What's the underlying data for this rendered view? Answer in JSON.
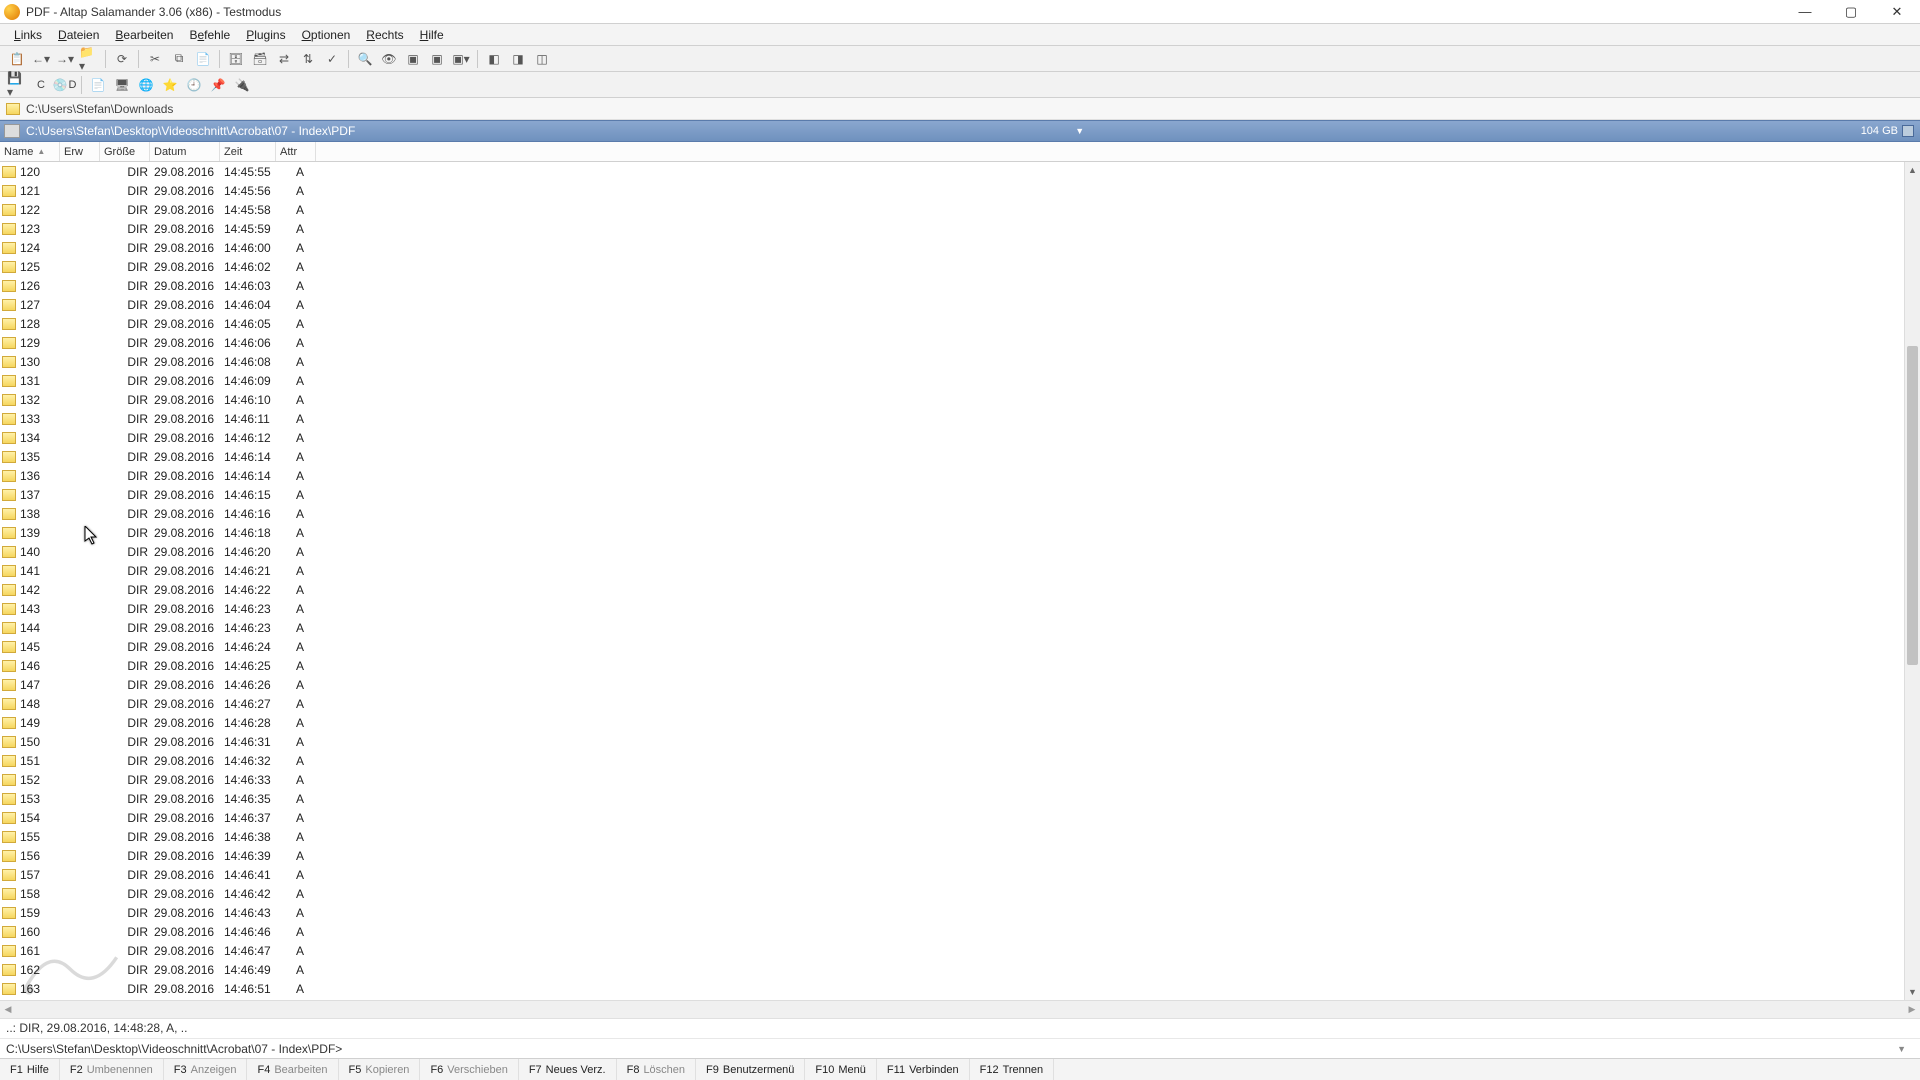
{
  "title": "PDF - Altap Salamander 3.06 (x86) - Testmodus",
  "menu": [
    "Links",
    "Dateien",
    "Bearbeiten",
    "Befehle",
    "Plugins",
    "Optionen",
    "Rechts",
    "Hilfe"
  ],
  "menu_accel": [
    "L",
    "D",
    "B",
    "e",
    "P",
    "O",
    "R",
    "H"
  ],
  "drivebar": {
    "c": "C",
    "d": "D"
  },
  "inactive_path": "C:\\Users\\Stefan\\Downloads",
  "active_path": "C:\\Users\\Stefan\\Desktop\\Videoschnitt\\Acrobat\\07 - Index\\PDF",
  "free_space": "104 GB",
  "columns": {
    "name": "Name",
    "ext": "Erw",
    "size": "Größe",
    "date": "Datum",
    "time": "Zeit",
    "attr": "Attr"
  },
  "rows": [
    {
      "name": "120",
      "size": "DIR",
      "date": "29.08.2016",
      "time": "14:45:55",
      "attr": "A"
    },
    {
      "name": "121",
      "size": "DIR",
      "date": "29.08.2016",
      "time": "14:45:56",
      "attr": "A"
    },
    {
      "name": "122",
      "size": "DIR",
      "date": "29.08.2016",
      "time": "14:45:58",
      "attr": "A"
    },
    {
      "name": "123",
      "size": "DIR",
      "date": "29.08.2016",
      "time": "14:45:59",
      "attr": "A"
    },
    {
      "name": "124",
      "size": "DIR",
      "date": "29.08.2016",
      "time": "14:46:00",
      "attr": "A"
    },
    {
      "name": "125",
      "size": "DIR",
      "date": "29.08.2016",
      "time": "14:46:02",
      "attr": "A"
    },
    {
      "name": "126",
      "size": "DIR",
      "date": "29.08.2016",
      "time": "14:46:03",
      "attr": "A"
    },
    {
      "name": "127",
      "size": "DIR",
      "date": "29.08.2016",
      "time": "14:46:04",
      "attr": "A"
    },
    {
      "name": "128",
      "size": "DIR",
      "date": "29.08.2016",
      "time": "14:46:05",
      "attr": "A"
    },
    {
      "name": "129",
      "size": "DIR",
      "date": "29.08.2016",
      "time": "14:46:06",
      "attr": "A"
    },
    {
      "name": "130",
      "size": "DIR",
      "date": "29.08.2016",
      "time": "14:46:08",
      "attr": "A"
    },
    {
      "name": "131",
      "size": "DIR",
      "date": "29.08.2016",
      "time": "14:46:09",
      "attr": "A"
    },
    {
      "name": "132",
      "size": "DIR",
      "date": "29.08.2016",
      "time": "14:46:10",
      "attr": "A"
    },
    {
      "name": "133",
      "size": "DIR",
      "date": "29.08.2016",
      "time": "14:46:11",
      "attr": "A"
    },
    {
      "name": "134",
      "size": "DIR",
      "date": "29.08.2016",
      "time": "14:46:12",
      "attr": "A"
    },
    {
      "name": "135",
      "size": "DIR",
      "date": "29.08.2016",
      "time": "14:46:14",
      "attr": "A"
    },
    {
      "name": "136",
      "size": "DIR",
      "date": "29.08.2016",
      "time": "14:46:14",
      "attr": "A"
    },
    {
      "name": "137",
      "size": "DIR",
      "date": "29.08.2016",
      "time": "14:46:15",
      "attr": "A"
    },
    {
      "name": "138",
      "size": "DIR",
      "date": "29.08.2016",
      "time": "14:46:16",
      "attr": "A"
    },
    {
      "name": "139",
      "size": "DIR",
      "date": "29.08.2016",
      "time": "14:46:18",
      "attr": "A"
    },
    {
      "name": "140",
      "size": "DIR",
      "date": "29.08.2016",
      "time": "14:46:20",
      "attr": "A"
    },
    {
      "name": "141",
      "size": "DIR",
      "date": "29.08.2016",
      "time": "14:46:21",
      "attr": "A"
    },
    {
      "name": "142",
      "size": "DIR",
      "date": "29.08.2016",
      "time": "14:46:22",
      "attr": "A"
    },
    {
      "name": "143",
      "size": "DIR",
      "date": "29.08.2016",
      "time": "14:46:23",
      "attr": "A"
    },
    {
      "name": "144",
      "size": "DIR",
      "date": "29.08.2016",
      "time": "14:46:23",
      "attr": "A"
    },
    {
      "name": "145",
      "size": "DIR",
      "date": "29.08.2016",
      "time": "14:46:24",
      "attr": "A"
    },
    {
      "name": "146",
      "size": "DIR",
      "date": "29.08.2016",
      "time": "14:46:25",
      "attr": "A"
    },
    {
      "name": "147",
      "size": "DIR",
      "date": "29.08.2016",
      "time": "14:46:26",
      "attr": "A"
    },
    {
      "name": "148",
      "size": "DIR",
      "date": "29.08.2016",
      "time": "14:46:27",
      "attr": "A"
    },
    {
      "name": "149",
      "size": "DIR",
      "date": "29.08.2016",
      "time": "14:46:28",
      "attr": "A"
    },
    {
      "name": "150",
      "size": "DIR",
      "date": "29.08.2016",
      "time": "14:46:31",
      "attr": "A"
    },
    {
      "name": "151",
      "size": "DIR",
      "date": "29.08.2016",
      "time": "14:46:32",
      "attr": "A"
    },
    {
      "name": "152",
      "size": "DIR",
      "date": "29.08.2016",
      "time": "14:46:33",
      "attr": "A"
    },
    {
      "name": "153",
      "size": "DIR",
      "date": "29.08.2016",
      "time": "14:46:35",
      "attr": "A"
    },
    {
      "name": "154",
      "size": "DIR",
      "date": "29.08.2016",
      "time": "14:46:37",
      "attr": "A"
    },
    {
      "name": "155",
      "size": "DIR",
      "date": "29.08.2016",
      "time": "14:46:38",
      "attr": "A"
    },
    {
      "name": "156",
      "size": "DIR",
      "date": "29.08.2016",
      "time": "14:46:39",
      "attr": "A"
    },
    {
      "name": "157",
      "size": "DIR",
      "date": "29.08.2016",
      "time": "14:46:41",
      "attr": "A"
    },
    {
      "name": "158",
      "size": "DIR",
      "date": "29.08.2016",
      "time": "14:46:42",
      "attr": "A"
    },
    {
      "name": "159",
      "size": "DIR",
      "date": "29.08.2016",
      "time": "14:46:43",
      "attr": "A"
    },
    {
      "name": "160",
      "size": "DIR",
      "date": "29.08.2016",
      "time": "14:46:46",
      "attr": "A"
    },
    {
      "name": "161",
      "size": "DIR",
      "date": "29.08.2016",
      "time": "14:46:47",
      "attr": "A"
    },
    {
      "name": "162",
      "size": "DIR",
      "date": "29.08.2016",
      "time": "14:46:49",
      "attr": "A"
    },
    {
      "name": "163",
      "size": "DIR",
      "date": "29.08.2016",
      "time": "14:46:51",
      "attr": "A"
    }
  ],
  "info_line": "..: DIR, 29.08.2016, 14:48:28, A, ..",
  "cmd_line": "C:\\Users\\Stefan\\Desktop\\Videoschnitt\\Acrobat\\07 - Index\\PDF>",
  "fkeys": [
    {
      "key": "F1",
      "label": "Hilfe",
      "active": true
    },
    {
      "key": "F2",
      "label": "Umbenennen",
      "active": false
    },
    {
      "key": "F3",
      "label": "Anzeigen",
      "active": false
    },
    {
      "key": "F4",
      "label": "Bearbeiten",
      "active": false
    },
    {
      "key": "F5",
      "label": "Kopieren",
      "active": false
    },
    {
      "key": "F6",
      "label": "Verschieben",
      "active": false
    },
    {
      "key": "F7",
      "label": "Neues Verz.",
      "active": true
    },
    {
      "key": "F8",
      "label": "Löschen",
      "active": false
    },
    {
      "key": "F9",
      "label": "Benutzermenü",
      "active": true
    },
    {
      "key": "F10",
      "label": "Menü",
      "active": true
    },
    {
      "key": "F11",
      "label": "Verbinden",
      "active": true
    },
    {
      "key": "F12",
      "label": "Trennen",
      "active": true
    }
  ]
}
